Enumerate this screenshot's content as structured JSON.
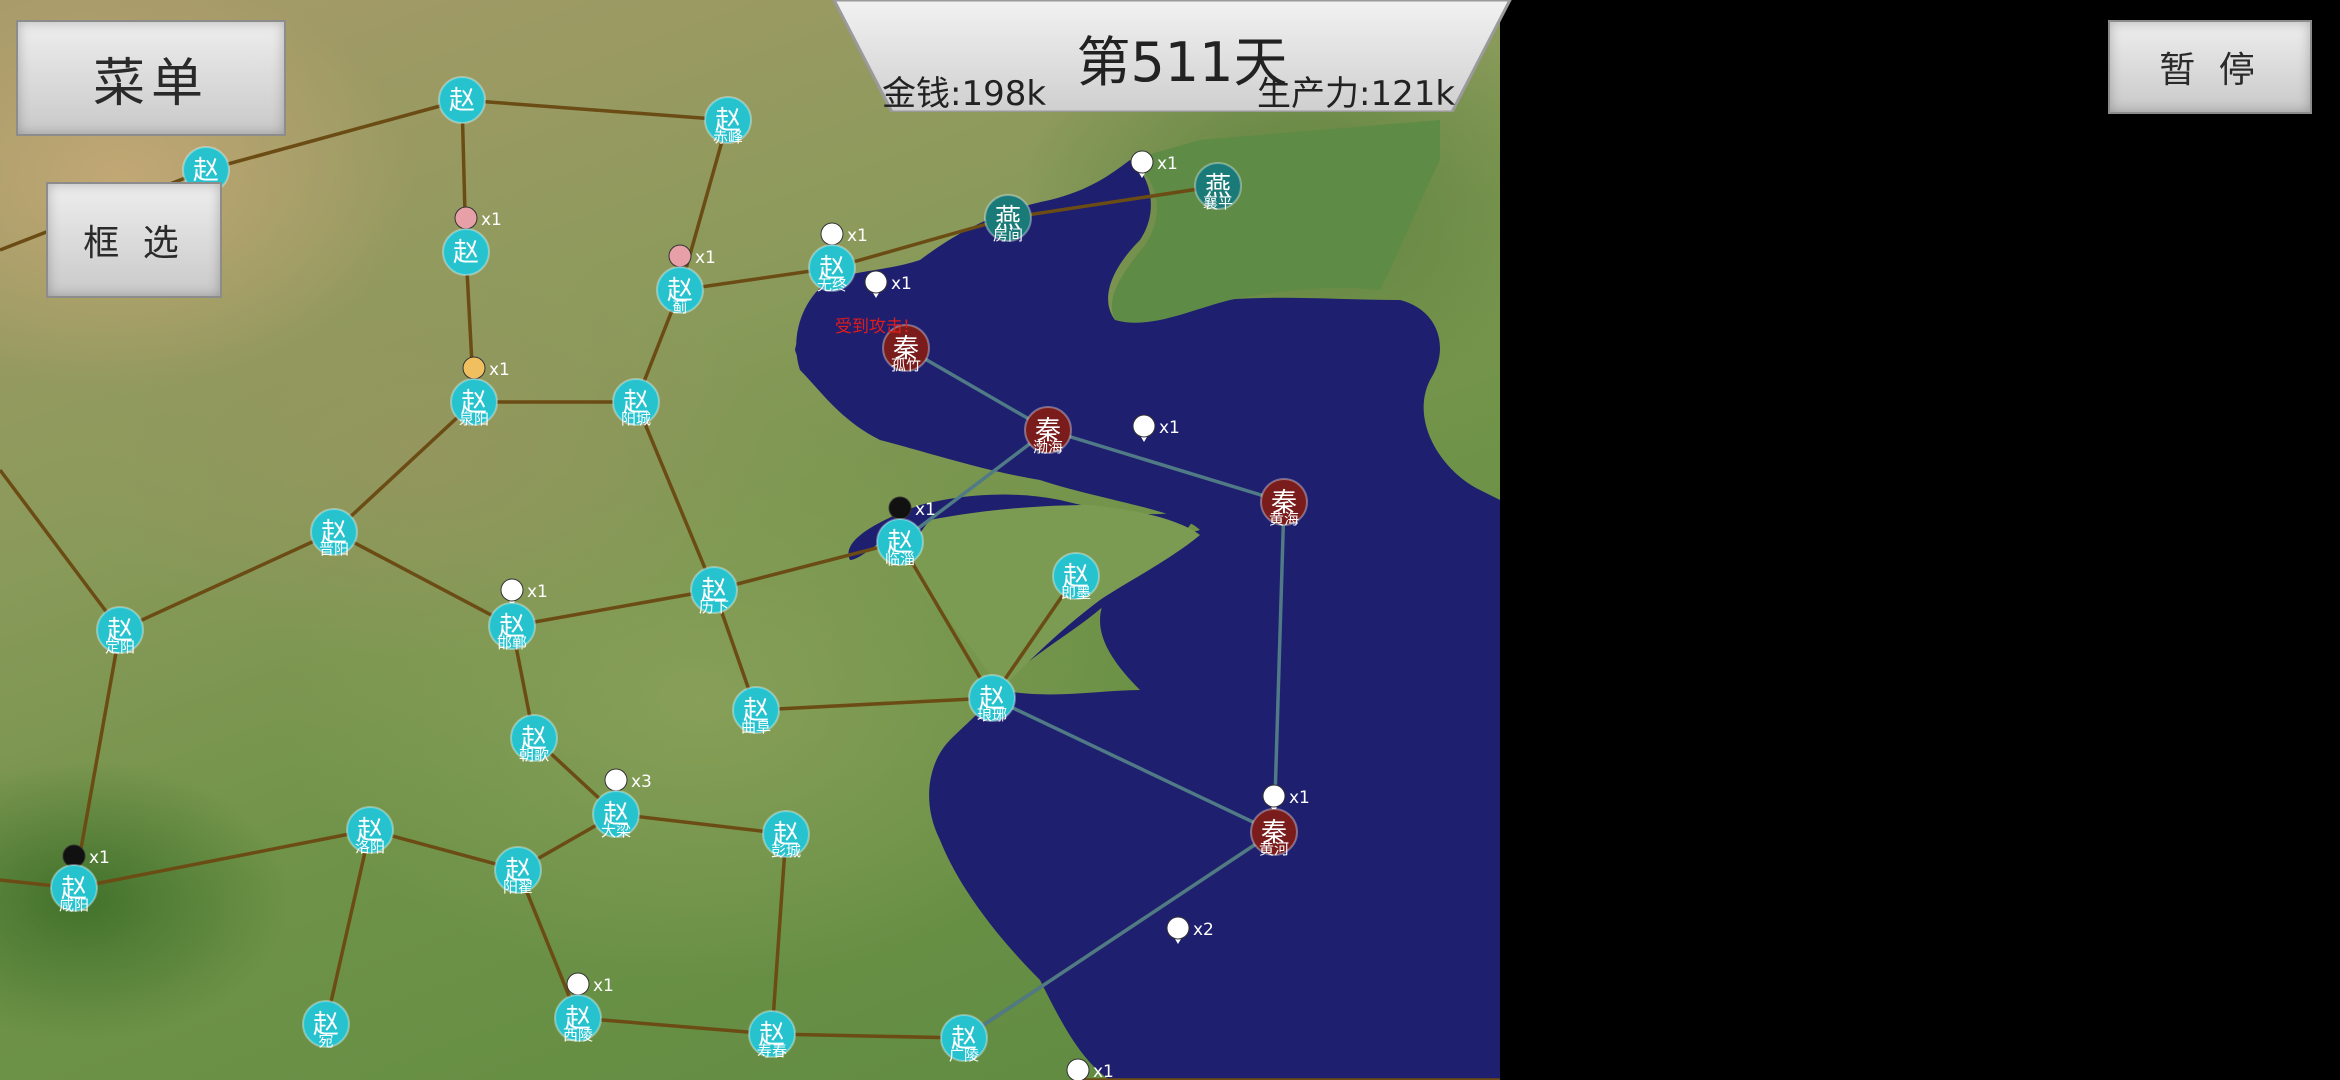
{
  "ui": {
    "menu_label": "菜单",
    "select_label": "框 选",
    "pause_label": "暂 停",
    "day_label": "第511天",
    "money_label": "金钱:198k",
    "production_label": "生产力:121k",
    "alert_text": "受到攻击!"
  },
  "factions": {
    "zhao": {
      "char": "赵",
      "color": "#26c3cf"
    },
    "qin": {
      "char": "秦",
      "color": "#7a1c1c"
    },
    "yan": {
      "char": "燕",
      "color": "#197a78"
    }
  },
  "cities": [
    {
      "id": "c1",
      "faction": "zhao",
      "name": ""
    },
    {
      "id": "c2",
      "faction": "zhao",
      "name": ""
    },
    {
      "id": "c3",
      "faction": "zhao",
      "name": "赤峰"
    },
    {
      "id": "c4",
      "faction": "zhao",
      "name": ""
    },
    {
      "id": "c5",
      "faction": "zhao",
      "name": "蓟"
    },
    {
      "id": "c6",
      "faction": "zhao",
      "name": "无终"
    },
    {
      "id": "c7",
      "faction": "yan",
      "name": "房间"
    },
    {
      "id": "c8",
      "faction": "yan",
      "name": "襄平"
    },
    {
      "id": "c9",
      "faction": "qin",
      "name": "孤竹"
    },
    {
      "id": "c10",
      "faction": "qin",
      "name": "渤海"
    },
    {
      "id": "c11",
      "faction": "qin",
      "name": "黄海"
    },
    {
      "id": "c12",
      "faction": "zhao",
      "name": "泉阳"
    },
    {
      "id": "c13",
      "faction": "zhao",
      "name": "阳城"
    },
    {
      "id": "c14",
      "faction": "zhao",
      "name": "晋阳"
    },
    {
      "id": "c15",
      "faction": "zhao",
      "name": "定阳"
    },
    {
      "id": "c16",
      "faction": "zhao",
      "name": "邯郸"
    },
    {
      "id": "c17",
      "faction": "zhao",
      "name": "历下"
    },
    {
      "id": "c18",
      "faction": "zhao",
      "name": "临淄"
    },
    {
      "id": "c19",
      "faction": "zhao",
      "name": "即墨"
    },
    {
      "id": "c20",
      "faction": "zhao",
      "name": "曲阜"
    },
    {
      "id": "c21",
      "faction": "zhao",
      "name": "琅琊"
    },
    {
      "id": "c22",
      "faction": "zhao",
      "name": "朝歌"
    },
    {
      "id": "c23",
      "faction": "zhao",
      "name": "洛阳"
    },
    {
      "id": "c24",
      "faction": "zhao",
      "name": "咸阳"
    },
    {
      "id": "c25",
      "faction": "zhao",
      "name": "阳翟"
    },
    {
      "id": "c26",
      "faction": "zhao",
      "name": "大梁"
    },
    {
      "id": "c27",
      "faction": "zhao",
      "name": "彭城"
    },
    {
      "id": "c28",
      "faction": "qin",
      "name": "黄河"
    },
    {
      "id": "c29",
      "faction": "zhao",
      "name": "宛"
    },
    {
      "id": "c30",
      "faction": "zhao",
      "name": "西陵"
    },
    {
      "id": "c31",
      "faction": "zhao",
      "name": "寿春"
    },
    {
      "id": "c32",
      "faction": "zhao",
      "name": "广陵"
    }
  ],
  "units": [
    {
      "id": "u1",
      "count": "x1",
      "color": "#e8a0a8"
    },
    {
      "id": "u2",
      "count": "x1",
      "color": "#e8a0a8"
    },
    {
      "id": "u3",
      "count": "x1",
      "color": "#ffffff"
    },
    {
      "id": "u4",
      "count": "x1",
      "color": "#ffffff"
    },
    {
      "id": "u5",
      "count": "x1",
      "color": "#ffffff"
    },
    {
      "id": "u6",
      "count": "x1",
      "color": "#f0c060"
    },
    {
      "id": "u7",
      "count": "x1",
      "color": "#ffffff"
    },
    {
      "id": "u8",
      "count": "x1",
      "color": "#111111"
    },
    {
      "id": "u9",
      "count": "x1",
      "color": "#ffffff"
    },
    {
      "id": "u10",
      "count": "x3",
      "color": "#ffffff"
    },
    {
      "id": "u11",
      "count": "x1",
      "color": "#111111"
    },
    {
      "id": "u12",
      "count": "x1",
      "color": "#ffffff"
    },
    {
      "id": "u13",
      "count": "x1",
      "color": "#ffffff"
    },
    {
      "id": "u14",
      "count": "x2",
      "color": "#ffffff"
    },
    {
      "id": "u15",
      "count": "x1",
      "color": "#ffffff"
    }
  ]
}
